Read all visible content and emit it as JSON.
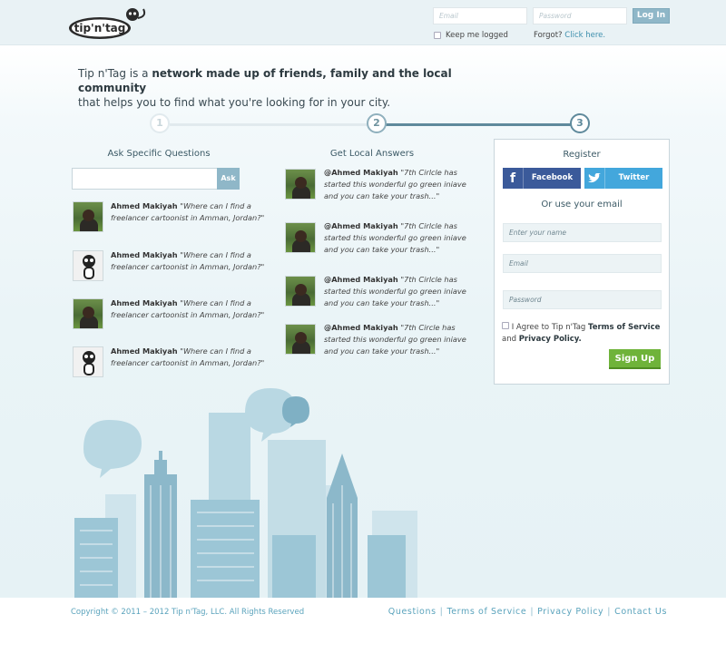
{
  "header": {
    "logo_text": "tip'n'tag",
    "email_placeholder": "Email",
    "password_placeholder": "Password",
    "login_label": "Log In",
    "keep_logged_label": "Keep me logged",
    "forgot_prefix": "Forgot?",
    "forgot_link": "Click here."
  },
  "intro": {
    "text_a": "Tip n'Tag is a ",
    "text_bold": "network made up of friends, family and the local community",
    "text_b": "that helps you to find what you're looking for in your city."
  },
  "steps": [
    "1",
    "2",
    "3"
  ],
  "ask_column": {
    "title": "Ask Specific Questions",
    "button_label": "Ask",
    "posts": [
      {
        "name": "Ahmed Makiyah",
        "text": "\"Where can I find a freelancer cartoonist in Amman, Jordan?\"",
        "avatar": "photo"
      },
      {
        "name": "Ahmed Makiyah",
        "text": "\"Where can I find a freelancer cartoonist in Amman, Jordan?\"",
        "avatar": "lemur"
      },
      {
        "name": "Ahmed Makiyah",
        "text": "\"Where can I find a freelancer cartoonist in Amman, Jordan?\"",
        "avatar": "photo"
      },
      {
        "name": "Ahmed Makiyah",
        "text": "\"Where can I find a freelancer cartoonist in Amman, Jordan?\"",
        "avatar": "lemur"
      }
    ]
  },
  "answers_column": {
    "title": "Get Local Answers",
    "posts": [
      {
        "name": "@Ahmed Makiyah",
        "text": "\"7th Cirlcle has started this wonderful go green iniave and you can take your trash...\""
      },
      {
        "name": "@Ahmed Makiyah",
        "text": "\"7th Cirlcle has started this wonderful go green iniave and you can take your trash...\""
      },
      {
        "name": "@Ahmed Makiyah",
        "text": "\"7th Cirlcle has started this wonderful go green iniave and you can take your trash...\""
      },
      {
        "name": "@Ahmed Makiyah",
        "text": "\"7th Circle has started this wonderful go green iniave and you can take your trash...\""
      }
    ]
  },
  "register": {
    "title": "Register",
    "facebook_label": "Facebook",
    "twitter_label": "Twitter",
    "or_email": "Or use your email",
    "name_placeholder": "Enter your name",
    "email_placeholder": "Email",
    "password_placeholder": "Password",
    "agree_prefix": "I Agree to Tip n'Tag ",
    "terms_label": "Terms of Service",
    "and": " and ",
    "privacy_label": "Privacy Policy.",
    "signup_label": "Sign Up"
  },
  "footer": {
    "copyright": "Copyright © 2011 – 2012 Tip n'Tag, LLC. All Rights Reserved",
    "links": [
      "Questions",
      "Terms of Service",
      "Privacy Policy",
      "Contact Us"
    ]
  },
  "colors": {
    "accent": "#8fb7c8",
    "facebook": "#3b5a9a",
    "twitter": "#43a7dc",
    "signup": "#6fb33a",
    "footer_link": "#5aa3bc"
  }
}
